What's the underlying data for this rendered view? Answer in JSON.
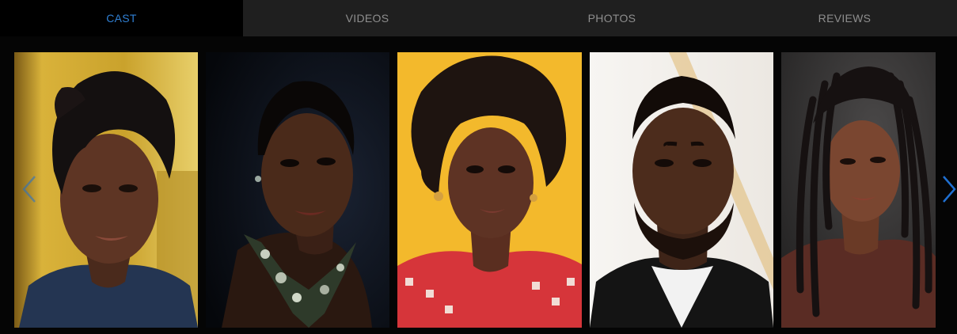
{
  "tabs": [
    {
      "label": "CAST",
      "active": true
    },
    {
      "label": "VIDEOS",
      "active": false
    },
    {
      "label": "PHOTOS",
      "active": false
    },
    {
      "label": "REVIEWS",
      "active": false
    }
  ],
  "colors": {
    "active_tab": "#2f7fd3",
    "inactive_tab": "#8e8e8e",
    "tab_bar": "#1f1f1f",
    "arrow": "#1f6fd0"
  },
  "carousel": {
    "prev_icon": "chevron-left-icon",
    "next_icon": "chevron-right-icon"
  }
}
